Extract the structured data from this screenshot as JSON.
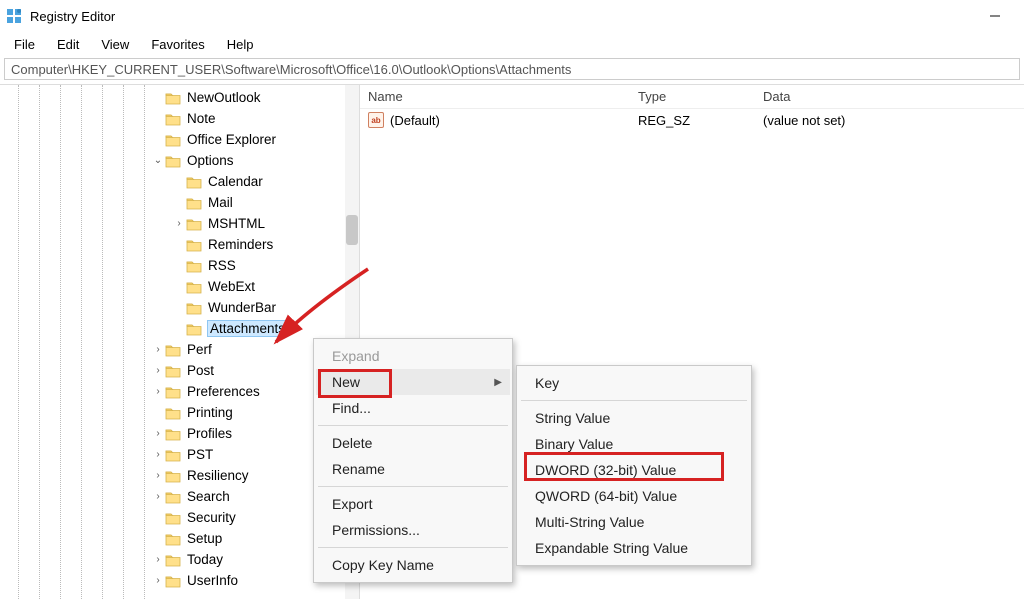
{
  "window": {
    "title": "Registry Editor"
  },
  "menubar": {
    "items": [
      "File",
      "Edit",
      "View",
      "Favorites",
      "Help"
    ]
  },
  "address": "Computer\\HKEY_CURRENT_USER\\Software\\Microsoft\\Office\\16.0\\Outlook\\Options\\Attachments",
  "tree": [
    {
      "indent": 165,
      "exp": "",
      "label": "NewOutlook"
    },
    {
      "indent": 165,
      "exp": "",
      "label": "Note"
    },
    {
      "indent": 165,
      "exp": "",
      "label": "Office Explorer"
    },
    {
      "indent": 165,
      "exp": "v",
      "label": "Options"
    },
    {
      "indent": 186,
      "exp": "",
      "label": "Calendar"
    },
    {
      "indent": 186,
      "exp": "",
      "label": "Mail"
    },
    {
      "indent": 186,
      "exp": ">",
      "label": "MSHTML"
    },
    {
      "indent": 186,
      "exp": "",
      "label": "Reminders"
    },
    {
      "indent": 186,
      "exp": "",
      "label": "RSS"
    },
    {
      "indent": 186,
      "exp": "",
      "label": "WebExt"
    },
    {
      "indent": 186,
      "exp": "",
      "label": "WunderBar"
    },
    {
      "indent": 186,
      "exp": "",
      "label": "Attachments",
      "selected": true
    },
    {
      "indent": 165,
      "exp": ">",
      "label": "Perf"
    },
    {
      "indent": 165,
      "exp": ">",
      "label": "Post"
    },
    {
      "indent": 165,
      "exp": ">",
      "label": "Preferences"
    },
    {
      "indent": 165,
      "exp": "",
      "label": "Printing"
    },
    {
      "indent": 165,
      "exp": ">",
      "label": "Profiles"
    },
    {
      "indent": 165,
      "exp": ">",
      "label": "PST"
    },
    {
      "indent": 165,
      "exp": ">",
      "label": "Resiliency"
    },
    {
      "indent": 165,
      "exp": ">",
      "label": "Search"
    },
    {
      "indent": 165,
      "exp": "",
      "label": "Security"
    },
    {
      "indent": 165,
      "exp": "",
      "label": "Setup"
    },
    {
      "indent": 165,
      "exp": ">",
      "label": "Today"
    },
    {
      "indent": 165,
      "exp": ">",
      "label": "UserInfo"
    }
  ],
  "list": {
    "headers": {
      "name": "Name",
      "type": "Type",
      "data": "Data"
    },
    "rows": [
      {
        "name": "(Default)",
        "type": "REG_SZ",
        "data": "(value not set)"
      }
    ]
  },
  "context_menu_1": {
    "expand": "Expand",
    "new": "New",
    "find": "Find...",
    "delete": "Delete",
    "rename": "Rename",
    "export": "Export",
    "permissions": "Permissions...",
    "copy_key_name": "Copy Key Name"
  },
  "context_menu_2": {
    "key": "Key",
    "string": "String Value",
    "binary": "Binary Value",
    "dword": "DWORD (32-bit) Value",
    "qword": "QWORD (64-bit) Value",
    "multi": "Multi-String Value",
    "expandable": "Expandable String Value"
  }
}
